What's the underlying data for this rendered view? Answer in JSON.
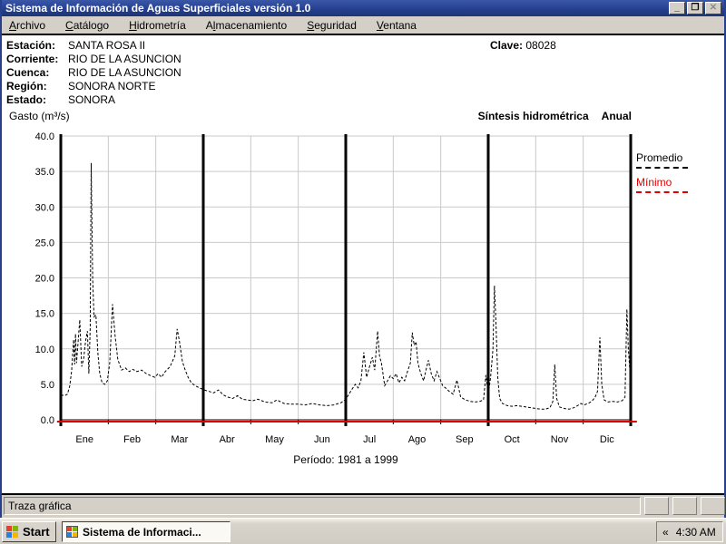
{
  "window": {
    "title": "Sistema de Información de Aguas Superficiales  versión 1.0",
    "controls": {
      "minimize": "_",
      "restore": "❐",
      "close": "✕"
    }
  },
  "menu": {
    "items": [
      {
        "label": "Archivo",
        "mnemonic": 0
      },
      {
        "label": "Catálogo",
        "mnemonic": 0
      },
      {
        "label": "Hidrometría",
        "mnemonic": 0
      },
      {
        "label": "Almacenamiento",
        "mnemonic": 1
      },
      {
        "label": "Seguridad",
        "mnemonic": 0
      },
      {
        "label": "Ventana",
        "mnemonic": 0
      }
    ]
  },
  "station": {
    "rows": [
      {
        "label": "Estación:",
        "value": "SANTA ROSA II"
      },
      {
        "label": "Corriente:",
        "value": "RIO DE LA ASUNCION"
      },
      {
        "label": "Cuenca:",
        "value": "RIO DE LA ASUNCION"
      },
      {
        "label": "Región:",
        "value": "SONORA NORTE"
      },
      {
        "label": "Estado:",
        "value": "SONORA"
      }
    ],
    "clave_label": "Clave:",
    "clave_value": "08028"
  },
  "chart_header": {
    "ylabel": "Gasto (m³/s)",
    "title": "Síntesis hidrométrica",
    "mode": "Anual"
  },
  "chart_data": {
    "type": "line",
    "title": "Síntesis hidrométrica Anual",
    "ylabel": "Gasto (m³/s)",
    "period_label": "Período:  1981 a 1999",
    "months": [
      "Ene",
      "Feb",
      "Mar",
      "Abr",
      "May",
      "Jun",
      "Jul",
      "Ago",
      "Sep",
      "Oct",
      "Nov",
      "Dic"
    ],
    "ylim": [
      0,
      40
    ],
    "yticks": [
      0,
      5,
      10,
      15,
      20,
      25,
      30,
      35,
      40
    ],
    "grid": true,
    "legend_position": "right",
    "series": [
      {
        "name": "Promedio",
        "color": "#000000",
        "style": "dashed",
        "width": 1,
        "points": [
          [
            0.0,
            3.5
          ],
          [
            0.08,
            3.4
          ],
          [
            0.14,
            3.6
          ],
          [
            0.19,
            4.8
          ],
          [
            0.23,
            7.0
          ],
          [
            0.27,
            11.3
          ],
          [
            0.29,
            7.8
          ],
          [
            0.31,
            12.1
          ],
          [
            0.33,
            8.0
          ],
          [
            0.36,
            10.5
          ],
          [
            0.4,
            14.1
          ],
          [
            0.44,
            7.5
          ],
          [
            0.48,
            8.5
          ],
          [
            0.52,
            11.0
          ],
          [
            0.56,
            12.5
          ],
          [
            0.59,
            6.5
          ],
          [
            0.62,
            13.0
          ],
          [
            0.64,
            36.2
          ],
          [
            0.67,
            20.0
          ],
          [
            0.7,
            14.5
          ],
          [
            0.74,
            14.8
          ],
          [
            0.78,
            9.5
          ],
          [
            0.82,
            6.5
          ],
          [
            0.87,
            5.2
          ],
          [
            0.93,
            5.0
          ],
          [
            0.98,
            5.5
          ],
          [
            1.03,
            8.0
          ],
          [
            1.09,
            16.3
          ],
          [
            1.14,
            12.0
          ],
          [
            1.2,
            8.5
          ],
          [
            1.28,
            7.0
          ],
          [
            1.36,
            7.3
          ],
          [
            1.44,
            6.8
          ],
          [
            1.52,
            7.1
          ],
          [
            1.6,
            6.8
          ],
          [
            1.7,
            7.0
          ],
          [
            1.8,
            6.5
          ],
          [
            1.9,
            6.2
          ],
          [
            1.98,
            6.0
          ],
          [
            2.05,
            6.5
          ],
          [
            2.12,
            6.0
          ],
          [
            2.2,
            6.8
          ],
          [
            2.3,
            7.5
          ],
          [
            2.4,
            9.0
          ],
          [
            2.45,
            12.8
          ],
          [
            2.5,
            11.0
          ],
          [
            2.56,
            8.2
          ],
          [
            2.62,
            7.0
          ],
          [
            2.68,
            6.0
          ],
          [
            2.75,
            5.2
          ],
          [
            2.83,
            4.8
          ],
          [
            2.92,
            4.5
          ],
          [
            3.02,
            4.2
          ],
          [
            3.12,
            4.0
          ],
          [
            3.22,
            3.8
          ],
          [
            3.32,
            4.2
          ],
          [
            3.42,
            3.5
          ],
          [
            3.52,
            3.2
          ],
          [
            3.62,
            3.0
          ],
          [
            3.72,
            3.4
          ],
          [
            3.82,
            2.9
          ],
          [
            3.92,
            2.8
          ],
          [
            4.05,
            2.7
          ],
          [
            4.15,
            2.9
          ],
          [
            4.3,
            2.5
          ],
          [
            4.45,
            2.4
          ],
          [
            4.55,
            2.8
          ],
          [
            4.7,
            2.3
          ],
          [
            4.85,
            2.2
          ],
          [
            5.0,
            2.2
          ],
          [
            5.15,
            2.1
          ],
          [
            5.3,
            2.3
          ],
          [
            5.45,
            2.1
          ],
          [
            5.6,
            2.0
          ],
          [
            5.75,
            2.1
          ],
          [
            5.9,
            2.4
          ],
          [
            5.98,
            2.8
          ],
          [
            6.05,
            3.4
          ],
          [
            6.12,
            4.2
          ],
          [
            6.2,
            5.0
          ],
          [
            6.26,
            4.5
          ],
          [
            6.32,
            5.5
          ],
          [
            6.38,
            9.5
          ],
          [
            6.44,
            6.0
          ],
          [
            6.5,
            7.5
          ],
          [
            6.56,
            8.8
          ],
          [
            6.61,
            7.0
          ],
          [
            6.67,
            12.5
          ],
          [
            6.71,
            9.0
          ],
          [
            6.75,
            8.0
          ],
          [
            6.82,
            4.8
          ],
          [
            6.88,
            5.5
          ],
          [
            6.94,
            6.2
          ],
          [
            7.0,
            5.8
          ],
          [
            7.06,
            6.5
          ],
          [
            7.12,
            5.2
          ],
          [
            7.18,
            6.0
          ],
          [
            7.24,
            5.5
          ],
          [
            7.3,
            6.8
          ],
          [
            7.36,
            8.0
          ],
          [
            7.4,
            12.3
          ],
          [
            7.44,
            10.5
          ],
          [
            7.48,
            11.0
          ],
          [
            7.52,
            8.0
          ],
          [
            7.58,
            6.5
          ],
          [
            7.64,
            5.5
          ],
          [
            7.69,
            7.0
          ],
          [
            7.74,
            8.4
          ],
          [
            7.8,
            6.5
          ],
          [
            7.86,
            5.5
          ],
          [
            7.92,
            6.8
          ],
          [
            7.98,
            5.8
          ],
          [
            8.04,
            4.8
          ],
          [
            8.1,
            4.5
          ],
          [
            8.18,
            4.0
          ],
          [
            8.26,
            3.6
          ],
          [
            8.34,
            5.6
          ],
          [
            8.42,
            3.2
          ],
          [
            8.52,
            2.8
          ],
          [
            8.62,
            2.6
          ],
          [
            8.72,
            2.5
          ],
          [
            8.82,
            2.6
          ],
          [
            8.9,
            2.8
          ],
          [
            8.95,
            6.3
          ],
          [
            9.0,
            3.5
          ],
          [
            9.05,
            6.0
          ],
          [
            9.1,
            10.0
          ],
          [
            9.13,
            18.9
          ],
          [
            9.16,
            14.0
          ],
          [
            9.2,
            6.0
          ],
          [
            9.24,
            3.0
          ],
          [
            9.3,
            2.3
          ],
          [
            9.4,
            2.0
          ],
          [
            9.5,
            1.9
          ],
          [
            9.6,
            2.0
          ],
          [
            9.7,
            1.9
          ],
          [
            9.8,
            1.8
          ],
          [
            9.9,
            1.7
          ],
          [
            10.0,
            1.6
          ],
          [
            10.1,
            1.5
          ],
          [
            10.2,
            1.5
          ],
          [
            10.3,
            1.7
          ],
          [
            10.36,
            2.6
          ],
          [
            10.4,
            7.8
          ],
          [
            10.44,
            3.0
          ],
          [
            10.5,
            1.8
          ],
          [
            10.6,
            1.6
          ],
          [
            10.7,
            1.5
          ],
          [
            10.8,
            1.7
          ],
          [
            10.88,
            2.0
          ],
          [
            10.95,
            2.3
          ],
          [
            11.02,
            2.1
          ],
          [
            11.1,
            2.3
          ],
          [
            11.18,
            2.6
          ],
          [
            11.25,
            3.2
          ],
          [
            11.3,
            4.0
          ],
          [
            11.35,
            11.6
          ],
          [
            11.39,
            5.0
          ],
          [
            11.44,
            2.8
          ],
          [
            11.52,
            2.5
          ],
          [
            11.62,
            2.6
          ],
          [
            11.72,
            2.5
          ],
          [
            11.82,
            2.7
          ],
          [
            11.88,
            3.2
          ],
          [
            11.92,
            15.6
          ],
          [
            11.95,
            10.0
          ],
          [
            11.98,
            7.0
          ],
          [
            12.0,
            7.2
          ]
        ]
      },
      {
        "name": "Mínimo",
        "color": "#e00000",
        "style": "solid",
        "width": 2,
        "dy": 2,
        "points": [
          [
            -0.08,
            0
          ],
          [
            12.13,
            0
          ]
        ]
      }
    ]
  },
  "status_bar": {
    "text": "Traza gráfica"
  },
  "taskbar": {
    "start_label": "Start",
    "task_label": "Sistema de Informaci...",
    "tray_chevron": "«",
    "clock": "4:30 AM"
  }
}
